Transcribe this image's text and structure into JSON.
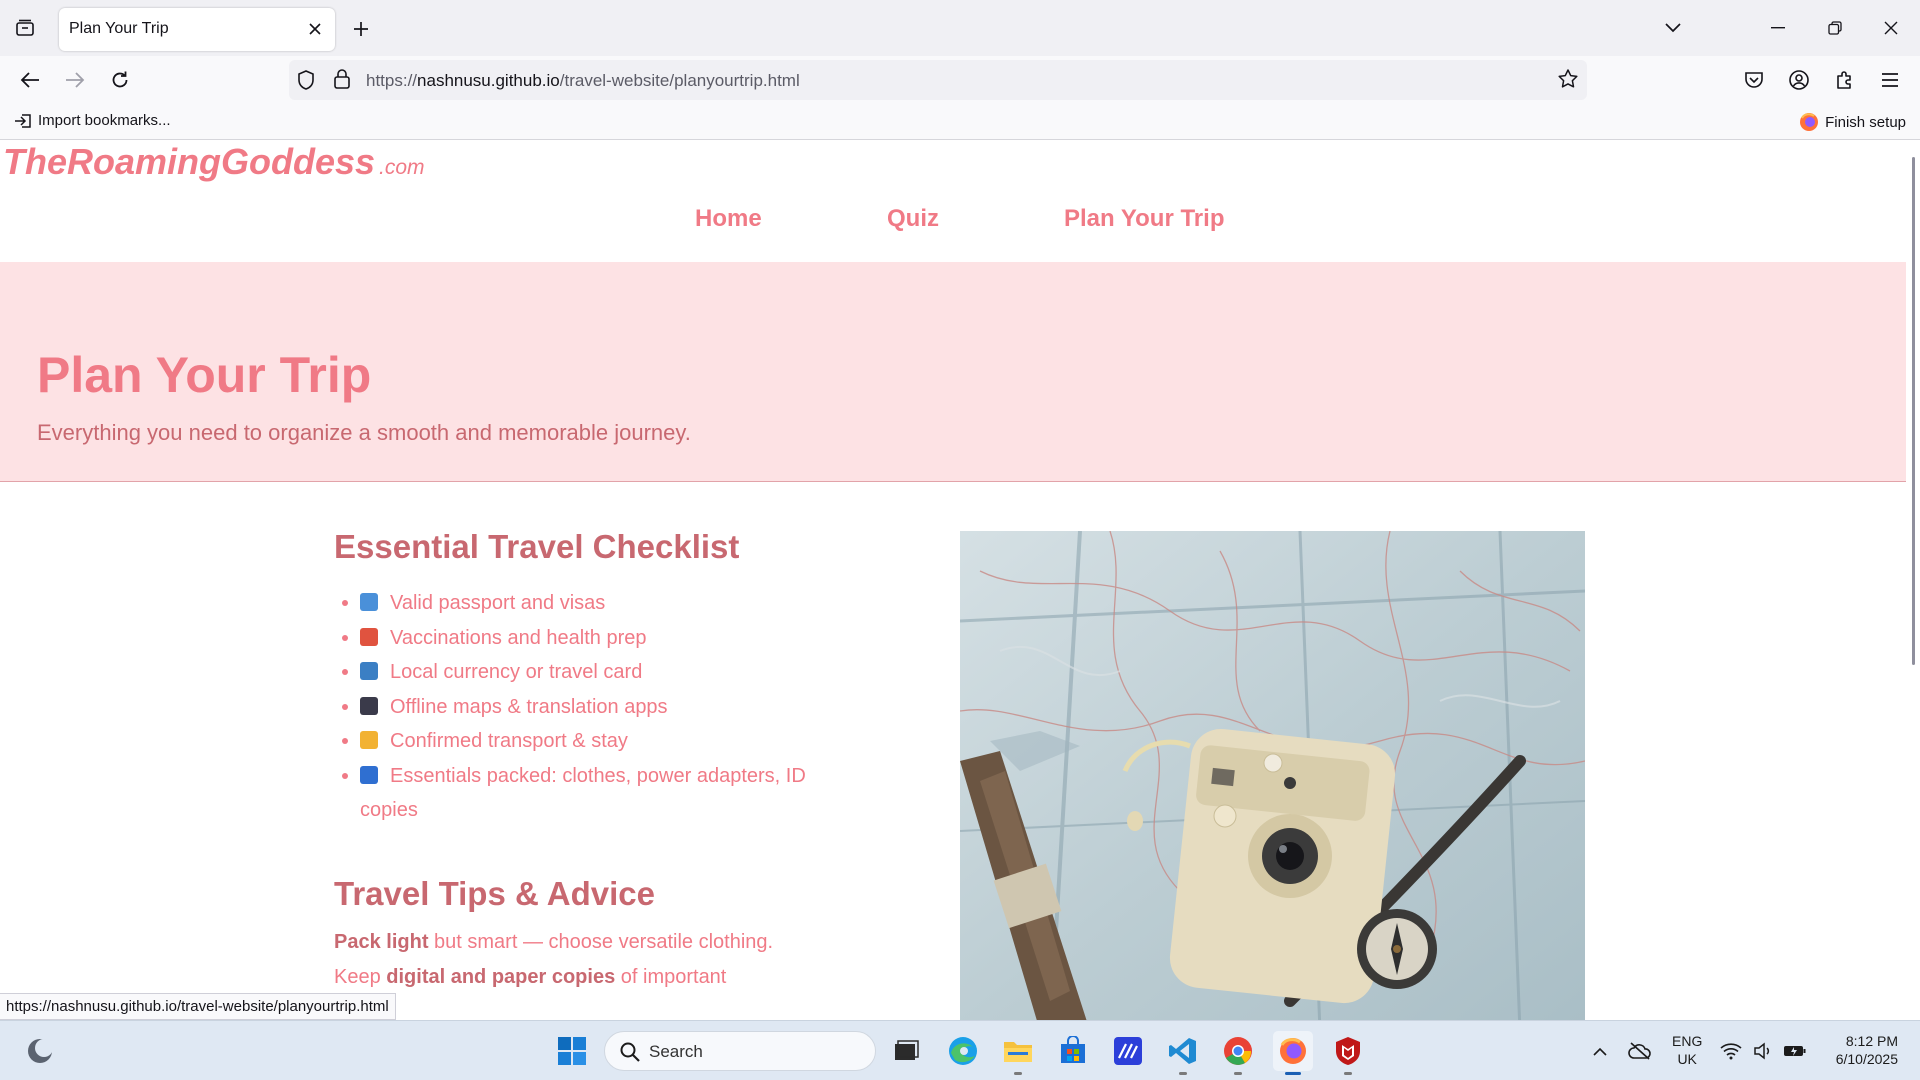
{
  "browser": {
    "tab_title": "Plan Your Trip",
    "url_prefix": "https://",
    "url_host": "nashnusu.github.io",
    "url_path": "/travel-website/planyourtrip.html",
    "import_bookmarks": "Import bookmarks...",
    "finish_setup": "Finish setup",
    "status_url": "https://nashnusu.github.io/travel-website/planyourtrip.html"
  },
  "site": {
    "logo_main": "TheRoamingGoddess",
    "logo_tld": ".com",
    "nav": [
      "Home",
      "Quiz",
      "Plan Your Trip"
    ]
  },
  "hero": {
    "title": "Plan Your Trip",
    "subtitle": "Everything you need to organize a smooth and memorable journey."
  },
  "checklist": {
    "heading": "Essential Travel Checklist",
    "items": [
      {
        "icon": "passport-emoji",
        "color": "#4a90d9",
        "text": "Valid passport and visas"
      },
      {
        "icon": "pill-emoji",
        "color": "#e0533f",
        "text": "Vaccinations and health prep"
      },
      {
        "icon": "credit-card-emoji",
        "color": "#3b7fc4",
        "text": "Local currency or travel card"
      },
      {
        "icon": "mobile-phone-emoji",
        "color": "#3a3a4a",
        "text": "Offline maps & translation apps"
      },
      {
        "icon": "ticket-emoji",
        "color": "#f2b233",
        "text": "Confirmed transport & stay"
      },
      {
        "icon": "luggage-emoji",
        "color": "#2f6fd1",
        "text": "Essentials packed: clothes, power adapters, ID copies"
      }
    ]
  },
  "tips": {
    "heading": "Travel Tips & Advice",
    "tip1_bold": "Pack light",
    "tip1_rest": " but smart — choose versatile clothing.",
    "tip2_pre": "Keep ",
    "tip2_bold": "digital and paper copies",
    "tip2_rest": " of important"
  },
  "taskbar": {
    "search_placeholder": "Search",
    "lang_top": "ENG",
    "lang_bottom": "UK",
    "time": "8:12 PM",
    "date": "6/10/2025"
  },
  "colors": {
    "accent_pink": "#f07a86",
    "hero_bg": "#fde2e4",
    "heading_rose": "#c86870"
  }
}
